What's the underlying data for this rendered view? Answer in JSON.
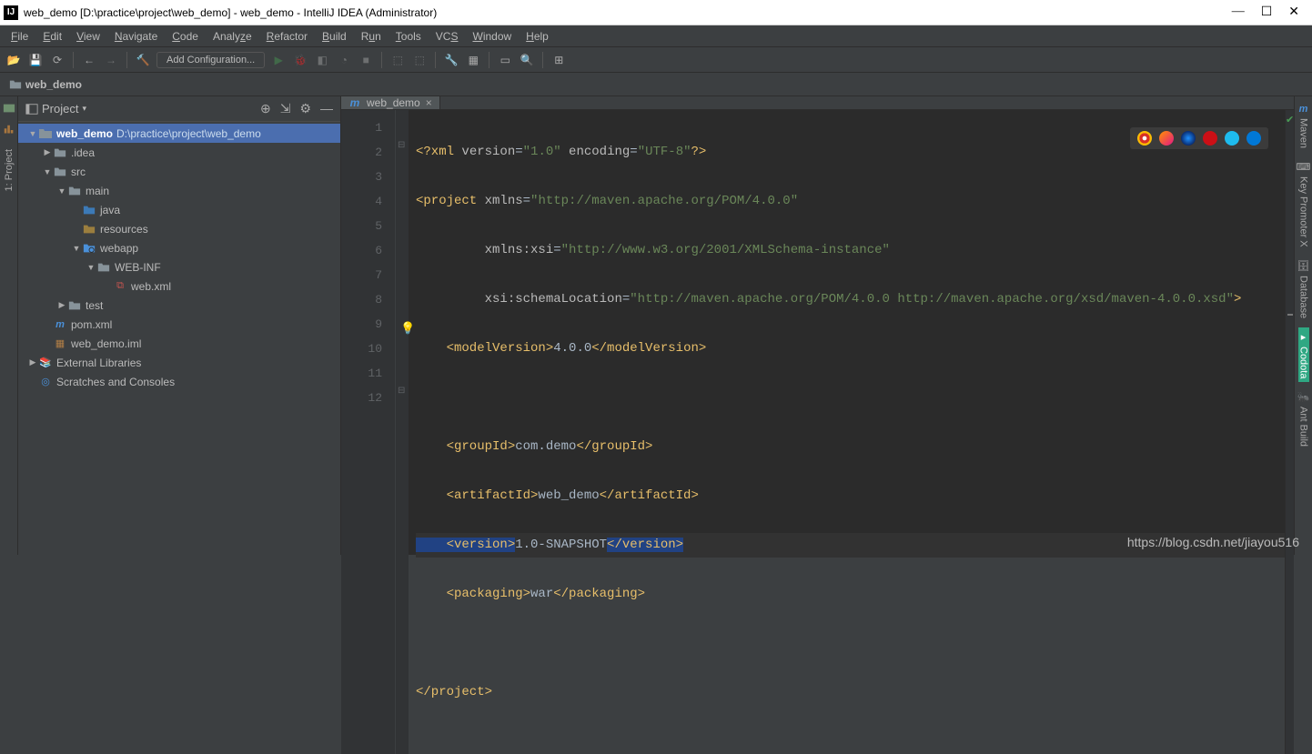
{
  "window": {
    "title": "web_demo [D:\\practice\\project\\web_demo] - web_demo - IntelliJ IDEA (Administrator)"
  },
  "menu": [
    "File",
    "Edit",
    "View",
    "Navigate",
    "Code",
    "Analyze",
    "Refactor",
    "Build",
    "Run",
    "Tools",
    "VCS",
    "Window",
    "Help"
  ],
  "toolbar": {
    "add_config": "Add Configuration..."
  },
  "breadcrumb": {
    "project": "web_demo"
  },
  "project_panel": {
    "title": "Project",
    "root": {
      "name": "web_demo",
      "path": "D:\\practice\\project\\web_demo"
    },
    "idea": ".idea",
    "src": "src",
    "main": "main",
    "java": "java",
    "resources": "resources",
    "webapp": "webapp",
    "webinf": "WEB-INF",
    "webxml": "web.xml",
    "test": "test",
    "pom": "pom.xml",
    "iml": "web_demo.iml",
    "ext": "External Libraries",
    "scratch": "Scratches and Consoles"
  },
  "left_tool": {
    "project_label": "1: Project"
  },
  "editor": {
    "tab": "web_demo",
    "lines": {
      "l1_a": "<?xml ",
      "l1_b": "version",
      "l1_c": "=",
      "l1_d": "\"1.0\"",
      "l1_e": " encoding",
      "l1_f": "=",
      "l1_g": "\"UTF-8\"",
      "l1_h": "?>",
      "l2_a": "<project ",
      "l2_b": "xmlns",
      "l2_c": "=",
      "l2_d": "\"http://maven.apache.org/POM/4.0.0\"",
      "l3_a": "         xmlns:",
      "l3_b": "xsi",
      "l3_c": "=",
      "l3_d": "\"http://www.w3.org/2001/XMLSchema-instance\"",
      "l4_a": "         xsi",
      "l4_b": ":schemaLocation",
      "l4_c": "=",
      "l4_d": "\"http://maven.apache.org/POM/4.0.0 http://maven.apache.org/xsd/maven-4.0.0.xsd\"",
      "l4_e": ">",
      "l5_a": "    <modelVersion>",
      "l5_b": "4.0.0",
      "l5_c": "</modelVersion>",
      "l7_a": "    <groupId>",
      "l7_b": "com.demo",
      "l7_c": "</groupId>",
      "l8_a": "    <artifactId>",
      "l8_b": "web_demo",
      "l8_c": "</artifactId>",
      "l9_a": "    <version>",
      "l9_b": "1.0-SNAPSHOT",
      "l9_c": "</version>",
      "l10_a": "    <packaging>",
      "l10_b": "war",
      "l10_c": "</packaging>",
      "l12_a": "</project>"
    },
    "line_numbers": [
      "1",
      "2",
      "3",
      "4",
      "5",
      "6",
      "7",
      "8",
      "9",
      "10",
      "11",
      "12"
    ]
  },
  "right_tool": [
    "Maven",
    "Key Promoter X",
    "Database",
    "Codota",
    "Ant Build"
  ],
  "watermark": "https://blog.csdn.net/jiayou516"
}
